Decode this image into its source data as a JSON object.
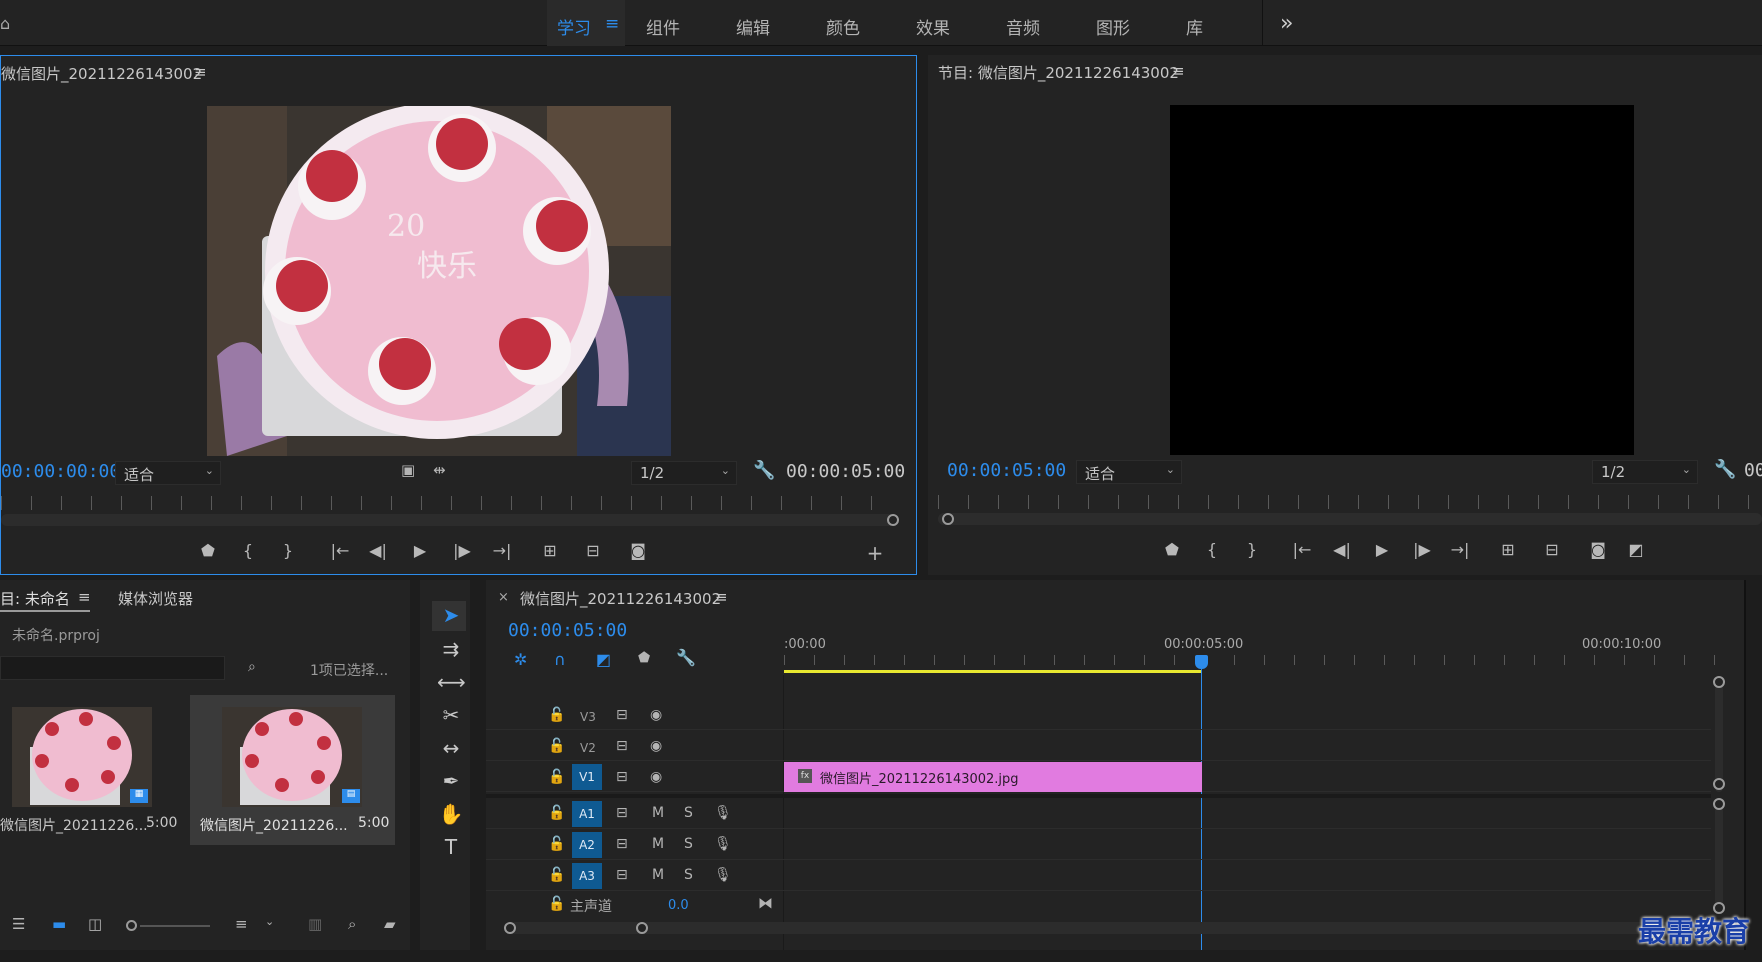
{
  "workspace_tabs": [
    "学习",
    "组件",
    "编辑",
    "颜色",
    "效果",
    "音频",
    "图形",
    "库"
  ],
  "workspace_more": "»",
  "menu_glyph": "≡",
  "source": {
    "title": "微信图片_20211226143002",
    "timecode": "00:00:00:00",
    "fit": "适合",
    "resolution": "1/2",
    "duration": "00:00:05:00"
  },
  "program": {
    "title": "节目: 微信图片_20211226143002",
    "timecode": "00:00:05:00",
    "fit": "适合",
    "resolution": "1/2",
    "duration_partial": "00"
  },
  "project": {
    "tab_project": "目: 未命名",
    "tab_media": "媒体浏览器",
    "file": "未命名.prproj",
    "selection": "1项已选择...",
    "items": [
      {
        "name": "微信图片_20211226...",
        "duration": "5:00",
        "selected": false
      },
      {
        "name": "微信图片_20211226...",
        "duration": "5:00",
        "selected": true
      }
    ]
  },
  "timeline": {
    "close": "×",
    "title": "微信图片_20211226143002",
    "timecode": "00:00:05:00",
    "ruler": [
      ":00:00",
      "00:00:05:00",
      "00:00:10:00"
    ],
    "video_tracks": [
      "V3",
      "V2",
      "V1"
    ],
    "audio_tracks": [
      "A1",
      "A2",
      "A3"
    ],
    "audio_m": "M",
    "audio_s": "S",
    "master_label": "主声道",
    "master_value": "0.0",
    "clip_name": "微信图片_20211226143002.jpg",
    "clip_fx": "fx"
  },
  "watermark": "最需教育",
  "colors": {
    "accent": "#2d8ceb",
    "clip": "#e17be0",
    "track_target": "#0f5a92",
    "work_area": "#e8e830"
  }
}
